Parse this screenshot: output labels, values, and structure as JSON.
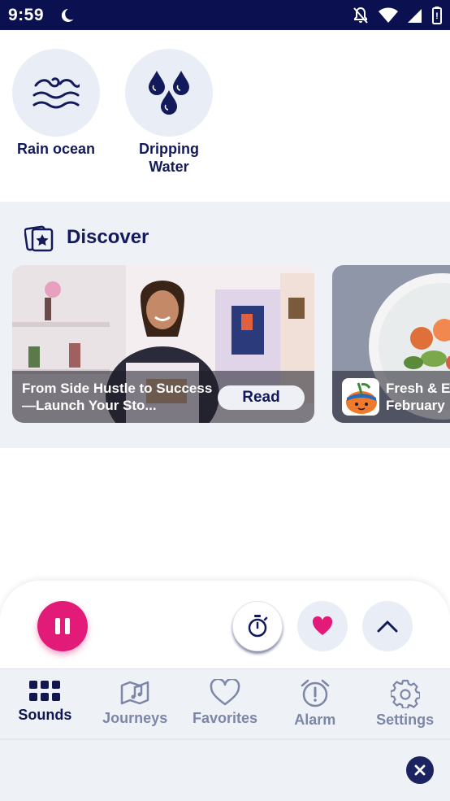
{
  "status_bar": {
    "time": "9:59"
  },
  "sounds": [
    {
      "label": "Rain ocean",
      "icon": "waves-icon"
    },
    {
      "label": "Dripping Water",
      "icon": "water-drops-icon"
    }
  ],
  "discover": {
    "title": "Discover",
    "cards": [
      {
        "text": "From Side Hustle to Success—Launch Your Sto...",
        "button": "Read"
      },
      {
        "text": "Fresh & E February"
      }
    ]
  },
  "player": {
    "pause_icon": "pause-icon",
    "timer_icon": "stopwatch-icon",
    "favorite_icon": "heart-icon",
    "expand_icon": "chevron-up-icon",
    "accent": "#e31b78"
  },
  "nav": {
    "items": [
      {
        "label": "Sounds",
        "active": true
      },
      {
        "label": "Journeys",
        "active": false
      },
      {
        "label": "Favorites",
        "active": false
      },
      {
        "label": "Alarm",
        "active": false
      },
      {
        "label": "Settings",
        "active": false
      }
    ]
  },
  "colors": {
    "primary": "#0f1650",
    "accent": "#e31b78",
    "surface": "#eef1f6"
  }
}
